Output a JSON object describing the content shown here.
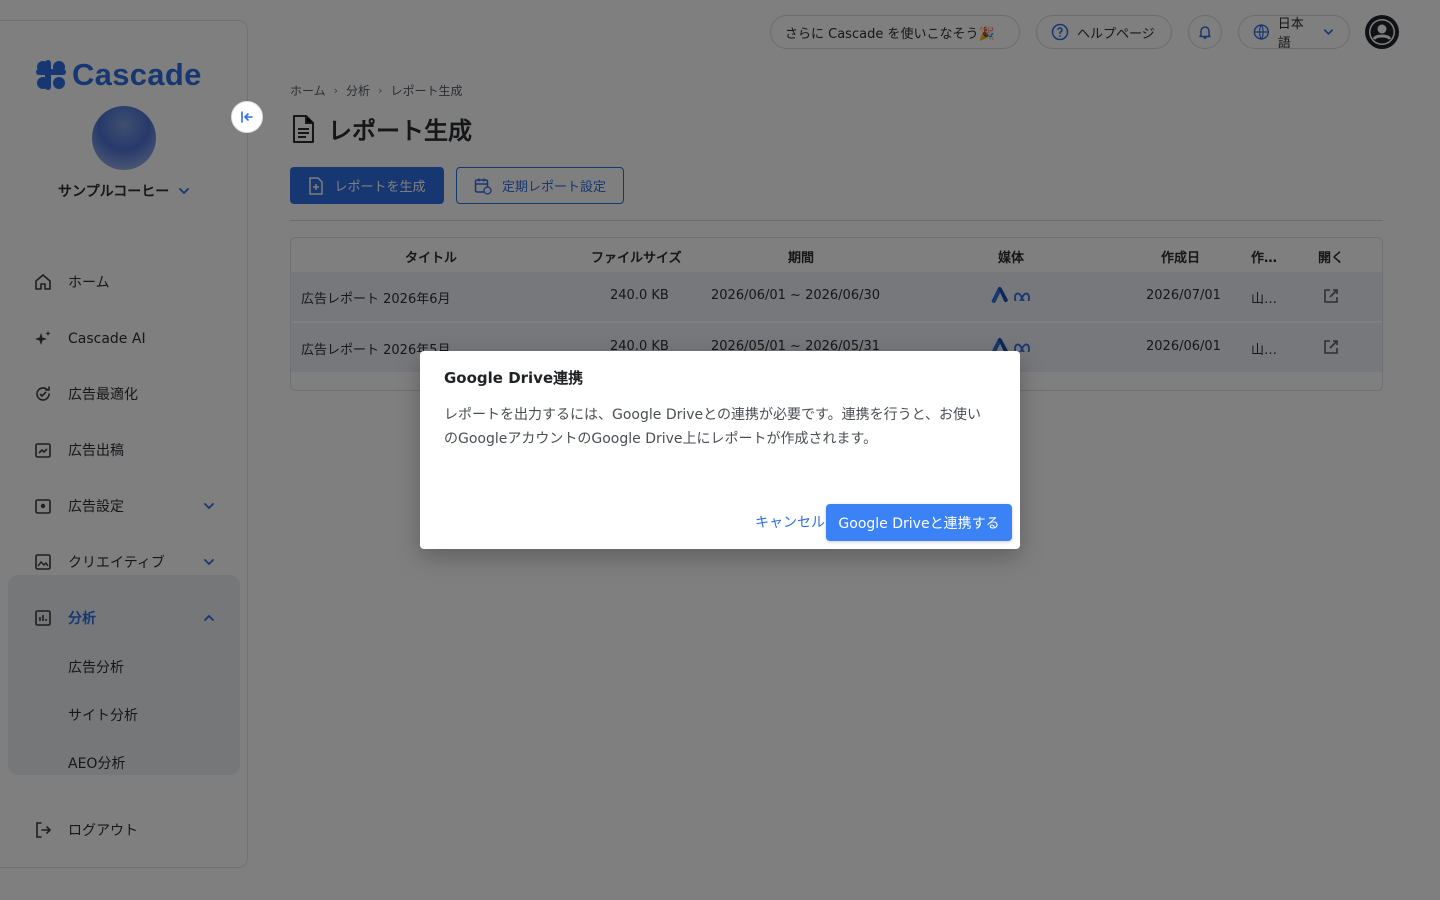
{
  "brand": {
    "name": "Cascade",
    "color": "#2f6fe4"
  },
  "account": {
    "name": "サンプルコーヒー"
  },
  "sidebar": {
    "items": [
      {
        "label": "ホーム",
        "icon": "home-icon"
      },
      {
        "label": "Cascade AI",
        "icon": "sparkle-icon"
      },
      {
        "label": "広告最適化",
        "icon": "optimize-icon"
      },
      {
        "label": "広告出稿",
        "icon": "ad-publish-icon"
      },
      {
        "label": "広告設定",
        "icon": "ad-settings-icon"
      },
      {
        "label": "クリエイティブ",
        "icon": "image-icon"
      },
      {
        "label": "分析",
        "icon": "analytics-icon"
      }
    ],
    "sub_items": [
      "広告分析",
      "サイト分析",
      "AEO分析"
    ],
    "logout": "ログアウト"
  },
  "topbar": {
    "promo": "さらに Cascade を使いこなそう🎉",
    "help": "ヘルプページ",
    "language": "日本語"
  },
  "breadcrumb": [
    "ホーム",
    "分析",
    "レポート生成"
  ],
  "page": {
    "title": "レポート生成",
    "primary_button": "レポートを生成",
    "secondary_button": "定期レポート設定"
  },
  "table": {
    "headers": [
      "タイトル",
      "ファイルサイズ",
      "期間",
      "媒体",
      "作成日",
      "作…",
      "開く"
    ],
    "rows": [
      {
        "title": "広告レポート 2026年6月",
        "size": "240.0 KB",
        "period": "2026/06/01 ~ 2026/06/30",
        "media": [
          "google-ads-icon",
          "meta-icon"
        ],
        "created": "2026/07/01",
        "author": "山…"
      },
      {
        "title": "広告レポート 2026年5月",
        "size": "240.0 KB",
        "period": "2026/05/01 ~ 2026/05/31",
        "media": [
          "google-ads-icon",
          "meta-icon"
        ],
        "created": "2026/06/01",
        "author": "山…"
      }
    ]
  },
  "dialog": {
    "title": "Google Drive連携",
    "body": "レポートを出力するには、Google Driveとの連携が必要です。連携を行うと、お使いのGoogleアカウントのGoogle Drive上にレポートが作成されます。",
    "cancel": "キャンセル",
    "confirm": "Google Driveと連携する"
  }
}
